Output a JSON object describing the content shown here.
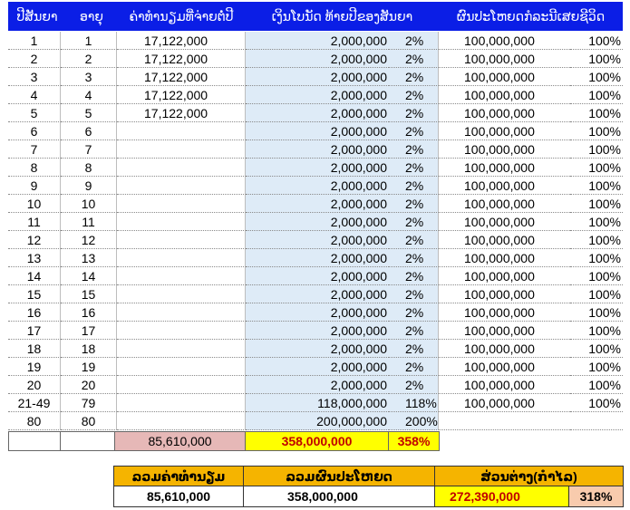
{
  "headers": {
    "year": "ປີສັນຍາ",
    "age": "ອາຍຸ",
    "premium": "ຄ່າທຳນຽມທີ່ຈ່າຍຕໍ່ປີ",
    "cash": "ເງິນໂບນັດ ທ້າຍປີຂອງສັນຍາ",
    "benefit": "ຜົນປະໂຫຍດກໍລະນີເສຍຊີວິດ"
  },
  "rows": [
    {
      "year": "1",
      "age": "1",
      "premium": "17,122,000",
      "cash": "2,000,000",
      "pct": "2%",
      "benefit": "100,000,000",
      "bpct": "100%"
    },
    {
      "year": "2",
      "age": "2",
      "premium": "17,122,000",
      "cash": "2,000,000",
      "pct": "2%",
      "benefit": "100,000,000",
      "bpct": "100%"
    },
    {
      "year": "3",
      "age": "3",
      "premium": "17,122,000",
      "cash": "2,000,000",
      "pct": "2%",
      "benefit": "100,000,000",
      "bpct": "100%"
    },
    {
      "year": "4",
      "age": "4",
      "premium": "17,122,000",
      "cash": "2,000,000",
      "pct": "2%",
      "benefit": "100,000,000",
      "bpct": "100%"
    },
    {
      "year": "5",
      "age": "5",
      "premium": "17,122,000",
      "cash": "2,000,000",
      "pct": "2%",
      "benefit": "100,000,000",
      "bpct": "100%"
    },
    {
      "year": "6",
      "age": "6",
      "premium": "",
      "cash": "2,000,000",
      "pct": "2%",
      "benefit": "100,000,000",
      "bpct": "100%"
    },
    {
      "year": "7",
      "age": "7",
      "premium": "",
      "cash": "2,000,000",
      "pct": "2%",
      "benefit": "100,000,000",
      "bpct": "100%"
    },
    {
      "year": "8",
      "age": "8",
      "premium": "",
      "cash": "2,000,000",
      "pct": "2%",
      "benefit": "100,000,000",
      "bpct": "100%"
    },
    {
      "year": "9",
      "age": "9",
      "premium": "",
      "cash": "2,000,000",
      "pct": "2%",
      "benefit": "100,000,000",
      "bpct": "100%"
    },
    {
      "year": "10",
      "age": "10",
      "premium": "",
      "cash": "2,000,000",
      "pct": "2%",
      "benefit": "100,000,000",
      "bpct": "100%"
    },
    {
      "year": "11",
      "age": "11",
      "premium": "",
      "cash": "2,000,000",
      "pct": "2%",
      "benefit": "100,000,000",
      "bpct": "100%"
    },
    {
      "year": "12",
      "age": "12",
      "premium": "",
      "cash": "2,000,000",
      "pct": "2%",
      "benefit": "100,000,000",
      "bpct": "100%"
    },
    {
      "year": "13",
      "age": "13",
      "premium": "",
      "cash": "2,000,000",
      "pct": "2%",
      "benefit": "100,000,000",
      "bpct": "100%"
    },
    {
      "year": "14",
      "age": "14",
      "premium": "",
      "cash": "2,000,000",
      "pct": "2%",
      "benefit": "100,000,000",
      "bpct": "100%"
    },
    {
      "year": "15",
      "age": "15",
      "premium": "",
      "cash": "2,000,000",
      "pct": "2%",
      "benefit": "100,000,000",
      "bpct": "100%"
    },
    {
      "year": "16",
      "age": "16",
      "premium": "",
      "cash": "2,000,000",
      "pct": "2%",
      "benefit": "100,000,000",
      "bpct": "100%"
    },
    {
      "year": "17",
      "age": "17",
      "premium": "",
      "cash": "2,000,000",
      "pct": "2%",
      "benefit": "100,000,000",
      "bpct": "100%"
    },
    {
      "year": "18",
      "age": "18",
      "premium": "",
      "cash": "2,000,000",
      "pct": "2%",
      "benefit": "100,000,000",
      "bpct": "100%"
    },
    {
      "year": "19",
      "age": "19",
      "premium": "",
      "cash": "2,000,000",
      "pct": "2%",
      "benefit": "100,000,000",
      "bpct": "100%"
    },
    {
      "year": "20",
      "age": "20",
      "premium": "",
      "cash": "2,000,000",
      "pct": "2%",
      "benefit": "100,000,000",
      "bpct": "100%"
    },
    {
      "year": "21-49",
      "age": "79",
      "premium": "",
      "cash": "118,000,000",
      "pct": "118%",
      "benefit": "100,000,000",
      "bpct": "100%"
    },
    {
      "year": "80",
      "age": "80",
      "premium": "",
      "cash": "200,000,000",
      "pct": "200%",
      "benefit": "",
      "bpct": ""
    }
  ],
  "totals": {
    "premium": "85,610,000",
    "cash": "358,000,000",
    "pct": "358%"
  },
  "summary": {
    "headers": {
      "total_premium": "ລວມຄ່າທຳນຽມ",
      "total_benefit": "ລວມຜົນປະໂຫຍດ",
      "difference": "ສ່ວນຕ່າງ(ກຳໄລ)"
    },
    "total_premium": "85,610,000",
    "total_benefit": "358,000,000",
    "difference": "272,390,000",
    "difference_pct": "318%"
  },
  "colors": {
    "header_blue": "#0b1ee6",
    "cash_column": "#deebf7",
    "total_premium_bg": "#e6b8b7",
    "total_highlight_bg": "#ffff00",
    "total_text_red": "#c00000",
    "summary_header_bg": "#f5b400",
    "summary_pct_bg": "#f8cbad"
  }
}
